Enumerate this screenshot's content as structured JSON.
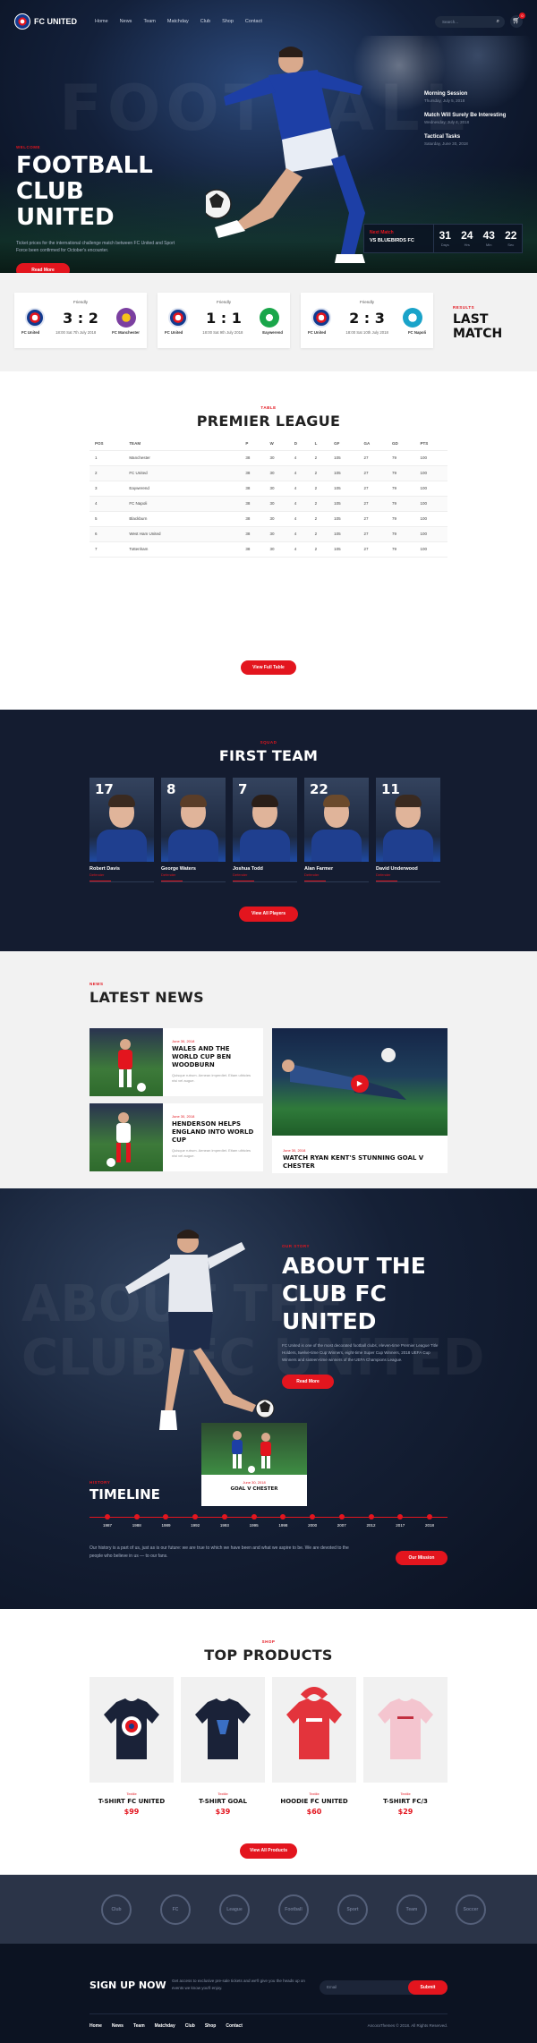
{
  "nav": {
    "logo": "FC UNITED",
    "menu": [
      "Home",
      "News",
      "Team",
      "Matchday",
      "Club",
      "Shop",
      "Contact"
    ],
    "search_placeholder": "Search...",
    "cart_count": "0"
  },
  "hero": {
    "bg_text": "FOOTBALL",
    "eyebrow": "Welcome",
    "title_line1": "FOOTBALL CLUB",
    "title_line2": "UNITED",
    "description": "Ticket prices for the international challenge match between FC United and Sport Force been confirmed for October's encounter.",
    "button": "Read More",
    "side_news": [
      {
        "title": "Morning Session",
        "date": "Thursday, July 5, 2018"
      },
      {
        "title": "Match Will Surely Be Interesting",
        "date": "Wednesday, July 4, 2018"
      },
      {
        "title": "Tactical Tasks",
        "date": "Saturday, June 30, 2018"
      }
    ],
    "next_match": {
      "label": "Next Match",
      "teams": "VS BLUEBIRDS FC"
    },
    "countdown": [
      {
        "n": "31",
        "l": "Days"
      },
      {
        "n": "24",
        "l": "Hrs"
      },
      {
        "n": "43",
        "l": "Min"
      },
      {
        "n": "22",
        "l": "Sec"
      }
    ]
  },
  "matches": {
    "cards": [
      {
        "type": "Friendly",
        "score": "3 : 2",
        "home": "FC United",
        "away": "FC Manchester",
        "date": "18:00 Sat 7th July 2018"
      },
      {
        "type": "Friendly",
        "score": "1 : 1",
        "home": "FC United",
        "away": "Eaywerend",
        "date": "18:00 Sat 9th July 2018"
      },
      {
        "type": "Friendly",
        "score": "2 : 3",
        "home": "FC United",
        "away": "FC Napoli",
        "date": "18:00 Sat 10th July 2018"
      }
    ],
    "eyebrow": "Results",
    "heading": "LAST MATCH"
  },
  "league": {
    "eyebrow": "Table",
    "heading": "PREMIER LEAGUE",
    "columns": [
      "POS",
      "TEAM",
      "P",
      "W",
      "D",
      "L",
      "GF",
      "GA",
      "GD",
      "PTS"
    ],
    "rows": [
      [
        "1",
        "Manchester",
        "38",
        "30",
        "4",
        "2",
        "105",
        "27",
        "79",
        "100"
      ],
      [
        "2",
        "FC United",
        "38",
        "30",
        "4",
        "2",
        "105",
        "27",
        "79",
        "100"
      ],
      [
        "3",
        "Eaywerend",
        "38",
        "30",
        "4",
        "2",
        "105",
        "27",
        "79",
        "100"
      ],
      [
        "4",
        "FC Napoli",
        "38",
        "30",
        "4",
        "2",
        "105",
        "27",
        "79",
        "100"
      ],
      [
        "5",
        "Blackburn",
        "38",
        "30",
        "4",
        "2",
        "105",
        "27",
        "79",
        "100"
      ],
      [
        "6",
        "West Ham United",
        "38",
        "30",
        "4",
        "2",
        "105",
        "27",
        "79",
        "100"
      ],
      [
        "7",
        "Tottenham",
        "38",
        "30",
        "4",
        "2",
        "105",
        "27",
        "79",
        "100"
      ]
    ],
    "button": "View Full Table"
  },
  "team": {
    "eyebrow": "Squad",
    "heading": "FIRST TEAM",
    "players": [
      {
        "num": "17",
        "name": "Robert Davis",
        "pos": "Defender"
      },
      {
        "num": "8",
        "name": "George Waters",
        "pos": "Defender"
      },
      {
        "num": "7",
        "name": "Joshua Todd",
        "pos": "Defender"
      },
      {
        "num": "22",
        "name": "Alan Farmer",
        "pos": "Defender"
      },
      {
        "num": "11",
        "name": "David Underwood",
        "pos": "Defender"
      }
    ],
    "button": "View All Players"
  },
  "news": {
    "eyebrow": "News",
    "heading": "LATEST NEWS",
    "items": [
      {
        "date": "June 30, 2018",
        "title": "WALES AND THE WORLD CUP BEN WOODBURN",
        "excerpt": "Quisque rutrum. Aenean imperdiet. Etiam ultricies nisi vel augue."
      },
      {
        "date": "June 30, 2018",
        "title": "HENDERSON HELPS ENGLAND INTO WORLD CUP",
        "excerpt": "Quisque rutrum. Aenean imperdiet. Etiam ultricies nisi vel augue."
      }
    ],
    "featured": {
      "date": "June 30, 2018",
      "title": "WATCH RYAN KENT'S STUNNING GOAL V CHESTER"
    }
  },
  "about": {
    "bg_text_line1": "ABOUT THE",
    "bg_text_line2": "CLUB FC UNITED",
    "eyebrow": "Our Story",
    "title_line1": "ABOUT THE",
    "title_line2": "CLUB FC UNITED",
    "description": "FC United is one of the most decorated football clubs, eleven-time Premier League Title Holders, twelve-time Cup Winners, eight-time Super Cup Winners, 2018 UEFA Cup Winners and sixteen-time winners of the UEFA Champions League.",
    "button": "Read More",
    "timeline_card": {
      "date": "June 30, 2018",
      "title": "GOAL V CHESTER"
    },
    "timeline_eyebrow": "History",
    "timeline_heading": "TIMELINE",
    "years": [
      "1987",
      "1988",
      "1989",
      "1992",
      "1993",
      "1995",
      "1998",
      "2000",
      "2007",
      "2012",
      "2017",
      "2018"
    ],
    "timeline_desc": "Our history is a part of us, just as is our future: we are true to which we have been and what we aspire to be. We are devoted to the people who believe in us — to our fans.",
    "mission_button": "Our Mission"
  },
  "products": {
    "eyebrow": "Shop",
    "heading": "TOP PRODUCTS",
    "items": [
      {
        "cat": "Textile",
        "name": "T-SHIRT FC UNITED",
        "price": "$99"
      },
      {
        "cat": "Textile",
        "name": "T-SHIRT GOAL",
        "price": "$39"
      },
      {
        "cat": "Textile",
        "name": "HOODIE FC UNITED",
        "price": "$60"
      },
      {
        "cat": "Textile",
        "name": "T-SHIRT FC/3",
        "price": "$29"
      }
    ],
    "button": "View All Products"
  },
  "partners": [
    "Club",
    "FC",
    "League",
    "Football",
    "Sport",
    "Team",
    "Soccer"
  ],
  "footer": {
    "signup": "SIGN UP NOW",
    "desc": "Get access to exclusive pre-sale tickets and we'll give you the heads up on events we know you'll enjoy.",
    "placeholder": "Email",
    "submit": "Submit",
    "menu": [
      "Home",
      "News",
      "Team",
      "Matchday",
      "Club",
      "Shop",
      "Contact"
    ],
    "copyright": "AncoraThemes © 2018. All Rights Reserved."
  }
}
